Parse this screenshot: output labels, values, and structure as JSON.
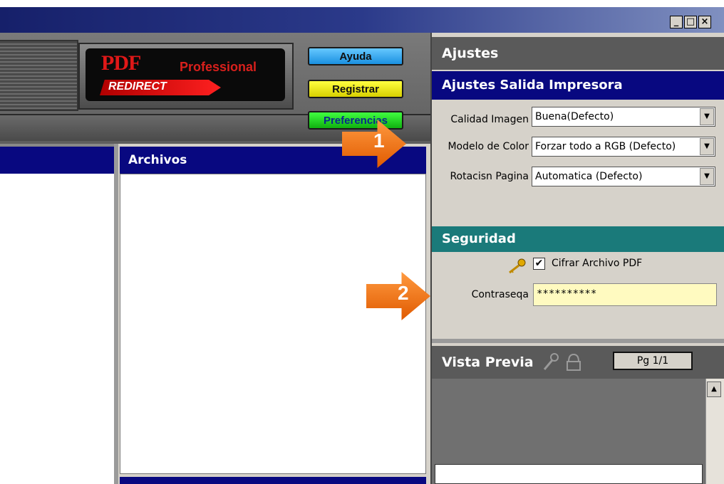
{
  "window": {
    "minimize_label": "_",
    "maximize_label": "□",
    "close_label": "×"
  },
  "logo": {
    "pdf": "PDF",
    "professional": "Professional",
    "redirect": "REDIRECT"
  },
  "header_buttons": {
    "ayuda": "Ayuda",
    "registrar": "Registrar",
    "preferencias": "Preferencias"
  },
  "files_panel": {
    "title": "Archivos"
  },
  "settings": {
    "title": "Ajustes",
    "printer_section": "Ajustes Salida Impresora",
    "fields": [
      {
        "label": "Calidad Imagen",
        "value": "Buena(Defecto)"
      },
      {
        "label": "Modelo de Color",
        "value": "Forzar todo a RGB (Defecto)"
      },
      {
        "label": "Rotacisn Pagina",
        "value": "Automatica (Defecto)"
      }
    ]
  },
  "security": {
    "title": "Seguridad",
    "encrypt_label": "Cifrar Archivo PDF",
    "encrypt_checked": "✔",
    "password_label": "Contraseqa",
    "password_value": "**********"
  },
  "preview": {
    "title": "Vista Previa",
    "page_indicator": "Pg 1/1"
  },
  "callouts": {
    "one": "1",
    "two": "2"
  },
  "icons": {
    "key": "key-icon",
    "lock": "lock-icon",
    "dropdown": "chevron-down-icon"
  },
  "colors": {
    "section_blue": "#080880",
    "section_teal": "#1a7a7a",
    "callout_orange": "#ff7a10"
  }
}
